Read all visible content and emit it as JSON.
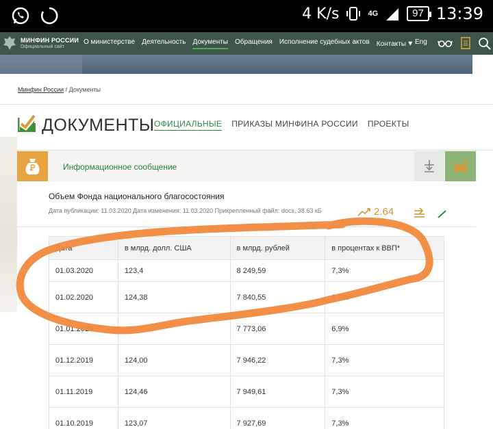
{
  "statusbar": {
    "speed": "4 K/s",
    "network": "4G",
    "battery": "97",
    "time": "13:39"
  },
  "header": {
    "logo_title": "МИНФИН РОССИИ",
    "logo_subtitle": "Официальный сайт",
    "nav": [
      "О министерстве",
      "Деятельность",
      "Документы",
      "Обращения",
      "Исполнение судебных актов",
      "Контакты"
    ],
    "lang": "Eng"
  },
  "breadcrumb": {
    "home": "Минфин России",
    "separator": "/",
    "current": "Документы"
  },
  "page": {
    "title": "ДОКУМЕНТЫ",
    "tabs": [
      "ОФИЦИАЛЬНЫЕ",
      "ПРИКАЗЫ МИНФИНА РОССИИ",
      "ПРОЕКТЫ"
    ]
  },
  "info": {
    "type": "Информационное сообщение"
  },
  "document": {
    "title": "Объем Фонда национального благосостояния",
    "meta": "Дата публикации:     11.03.2020 Дата изменения:     11.03.2020 Прикрепленный файл: docx, 38.63 кБ",
    "rating": "2.64"
  },
  "table": {
    "headers": [
      "Дата",
      "в млрд. долл. США",
      "в млрд. рублей",
      "в процентах к ВВП*"
    ],
    "rows": [
      [
        "01.03.2020",
        "123,4",
        "8 249,59",
        "7,3%"
      ],
      [
        "01.02.2020",
        "124,38",
        "7 840,55",
        "6,9%"
      ],
      [
        "01.01.2020",
        "",
        "7 773,06",
        "6,9%"
      ],
      [
        "01.12.2019",
        "124,00",
        "7 946,22",
        "7,3%"
      ],
      [
        "01.11.2019",
        "124,46",
        "7 949,61",
        "7,3%"
      ],
      [
        "01.10.2019",
        "123,07",
        "7 927,69",
        "7,3%"
      ]
    ]
  },
  "colors": {
    "status_bg": "#000000",
    "header_bg": "#3d5649",
    "accent_green": "#2e8b3a",
    "accent_orange": "#e6a340",
    "annotation": "#f0893c"
  }
}
